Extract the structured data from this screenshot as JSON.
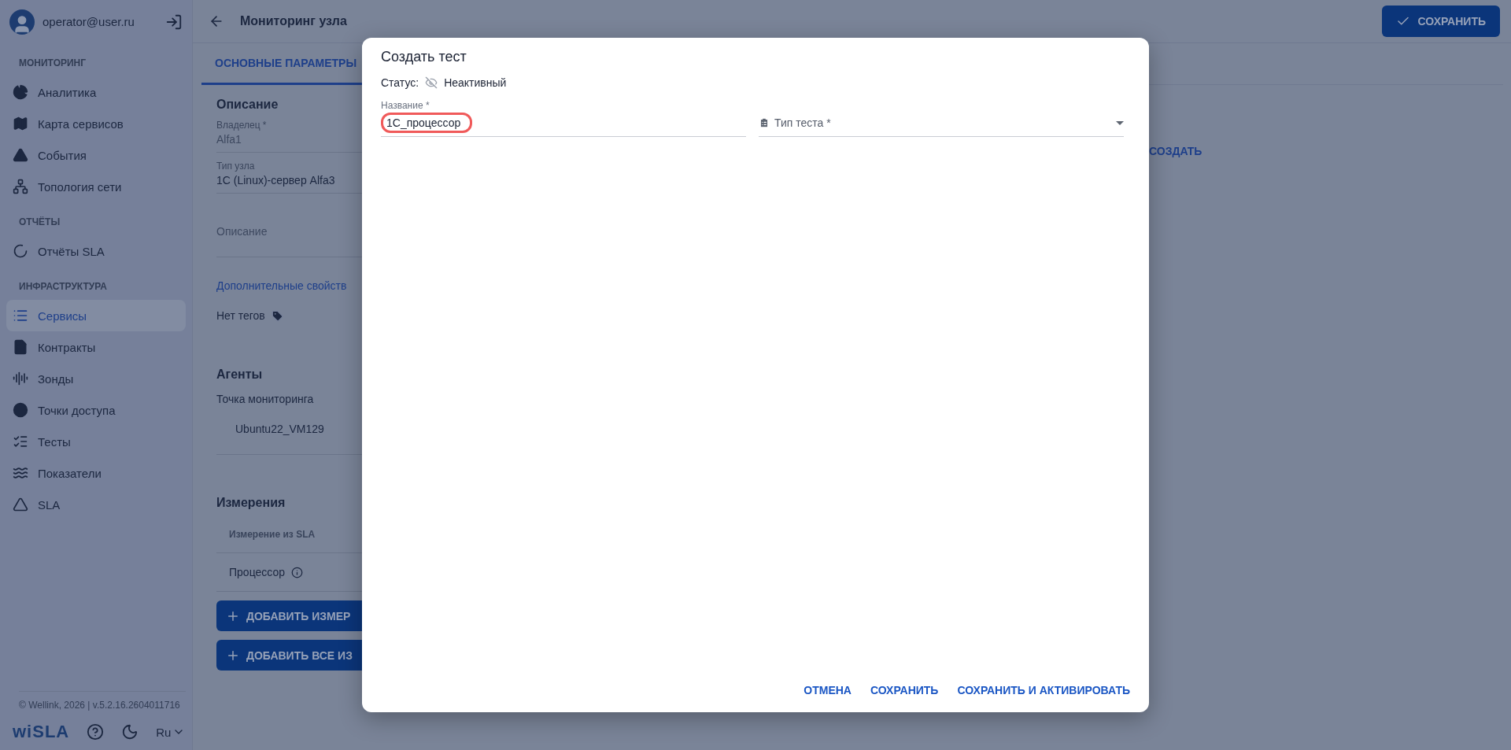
{
  "user": {
    "email": "operator@user.ru"
  },
  "sidebar": {
    "sections": [
      {
        "title": "МОНИТОРИНГ",
        "items": [
          {
            "label": "Аналитика",
            "selected": false
          },
          {
            "label": "Карта сервисов",
            "selected": false
          },
          {
            "label": "События",
            "selected": false
          },
          {
            "label": "Топология сети",
            "selected": false
          }
        ]
      },
      {
        "title": "ОТЧЁТЫ",
        "items": [
          {
            "label": "Отчёты SLA",
            "selected": false
          }
        ]
      },
      {
        "title": "ИНФРАСТРУКТУРА",
        "items": [
          {
            "label": "Сервисы",
            "selected": true
          },
          {
            "label": "Контракты",
            "selected": false
          },
          {
            "label": "Зонды",
            "selected": false
          },
          {
            "label": "Точки доступа",
            "selected": false
          },
          {
            "label": "Тесты",
            "selected": false
          },
          {
            "label": "Показатели",
            "selected": false
          },
          {
            "label": "SLA",
            "selected": false
          }
        ]
      }
    ],
    "footer": {
      "copyright": "© Wellink, 2026 | v.5.2.16.2604011716",
      "logo": "wiSLA",
      "language": "Ru"
    }
  },
  "header": {
    "title": "Мониторинг узла",
    "save_button": "СОХРАНИТЬ"
  },
  "tabs": [
    {
      "label": "ОСНОВНЫЕ ПАРАМЕТРЫ",
      "selected": true
    }
  ],
  "description": {
    "heading": "Описание",
    "owner": {
      "label": "Владелец *",
      "value": "Alfa1"
    },
    "node_type": {
      "label": "Тип узла",
      "value": "1C (Linux)-сервер Alfa3"
    },
    "description_placeholder": "Описание",
    "extra_link": "Дополнительные свойств",
    "tags": "Нет тегов"
  },
  "agents": {
    "heading": "Агенты",
    "label": "Точка мониторинга",
    "value": "Ubuntu22_VM129"
  },
  "measurements": {
    "heading": "Измерения",
    "column_1": "Измерение из SLA",
    "rows": [
      "Процессор"
    ],
    "buttons": [
      "ДОБАВИТЬ ИЗМЕР",
      "ДОБАВИТЬ ВСЕ ИЗ"
    ]
  },
  "right_link": "СОЗДАТЬ",
  "dialog": {
    "title": "Создать тест",
    "status_label": "Статус:",
    "status": "Неактивный",
    "name": {
      "label": "Название *",
      "value": "1C_процессор",
      "highlighted": true
    },
    "type": {
      "placeholder": "Тип теста *"
    },
    "buttons": [
      "ОТМЕНА",
      "СОХРАНИТЬ",
      "СОХРАНИТЬ И АКТИВИРОВАТЬ"
    ]
  }
}
